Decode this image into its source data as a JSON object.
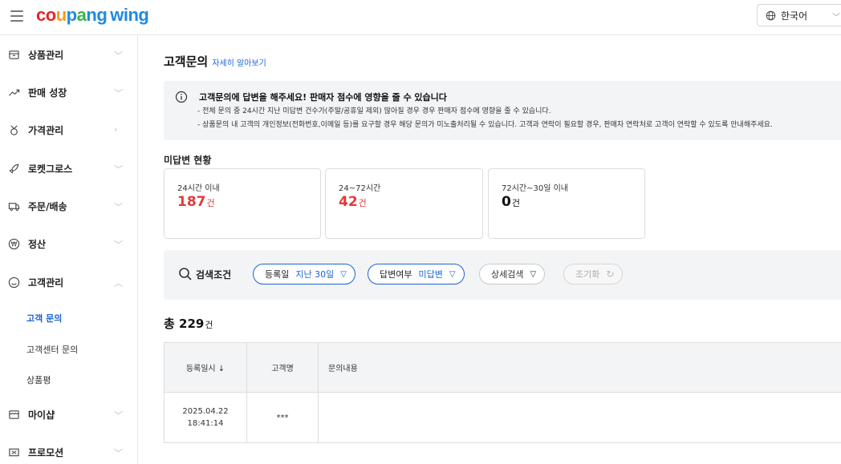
{
  "header": {
    "logo": {
      "coupang": [
        "c",
        "o",
        "u",
        "p",
        "a",
        "n",
        "g"
      ],
      "wing": "wing"
    },
    "language": "한국어"
  },
  "sidebar": {
    "items": [
      {
        "label": "상품관리",
        "icon": "box-icon"
      },
      {
        "label": "판매 성장",
        "icon": "trend-up-icon"
      },
      {
        "label": "가격관리",
        "icon": "price-tag-icon"
      },
      {
        "label": "로켓그로스",
        "icon": "rocket-icon"
      },
      {
        "label": "주문/배송",
        "icon": "truck-icon"
      },
      {
        "label": "정산",
        "icon": "won-coin-icon"
      },
      {
        "label": "고객관리",
        "icon": "smile-icon"
      },
      {
        "label": "마이샵",
        "icon": "shop-icon"
      },
      {
        "label": "프로모션",
        "icon": "promotion-icon"
      }
    ],
    "sub_items": [
      {
        "label": "고객 문의",
        "active": true
      },
      {
        "label": "고객센터 문의",
        "active": false
      },
      {
        "label": "상품평",
        "active": false
      }
    ]
  },
  "main": {
    "title": "고객문의",
    "learn_more": "자세히 알아보기",
    "notice": {
      "title": "고객문의에 답변을 해주세요! 판매자 점수에 영향을 줄 수 있습니다",
      "lines": [
        "- 전체 문의 중 24시간 지난 미답변 건수가(주말/공휴일 제외) 많아질 경우 경우 판매자 점수에 영향을 줄 수 있습니다.",
        "- 상품문의 내 고객의 개인정보(전화번호,이메일 등)를 요구할 경우 해당 문의가 미노출처리될 수 있습니다. 고객과 연락이 필요할 경우, 판매자 연락처로 고객이 연락할 수 있도록 안내해주세요."
      ]
    },
    "unanswered": {
      "label": "미답변 현황",
      "cards": [
        {
          "label": "24시간 이내",
          "value": "187",
          "unit": "건"
        },
        {
          "label": "24~72시간",
          "value": "42",
          "unit": "건"
        },
        {
          "label": "72시간~30일 이내",
          "value": "0",
          "unit": "건"
        }
      ]
    },
    "filters": {
      "search_label": "검색조건",
      "date": {
        "label": "등록일",
        "value": "지난 30일"
      },
      "answered": {
        "label": "답변여부",
        "value": "미답변"
      },
      "detail": "상세검색",
      "reset": "조기화"
    },
    "total": {
      "prefix": "총",
      "count": "229",
      "unit": "건"
    },
    "table": {
      "headers": [
        "등록일시 ↓",
        "고객명",
        "문의내용"
      ],
      "rows": [
        {
          "date": "2025.04.22",
          "time": "18:41:14",
          "customer": "***",
          "content": ""
        }
      ]
    }
  },
  "colors": {
    "accent": "#1a63d6",
    "alert": "#e53935",
    "panel": "#f3f4f6"
  }
}
